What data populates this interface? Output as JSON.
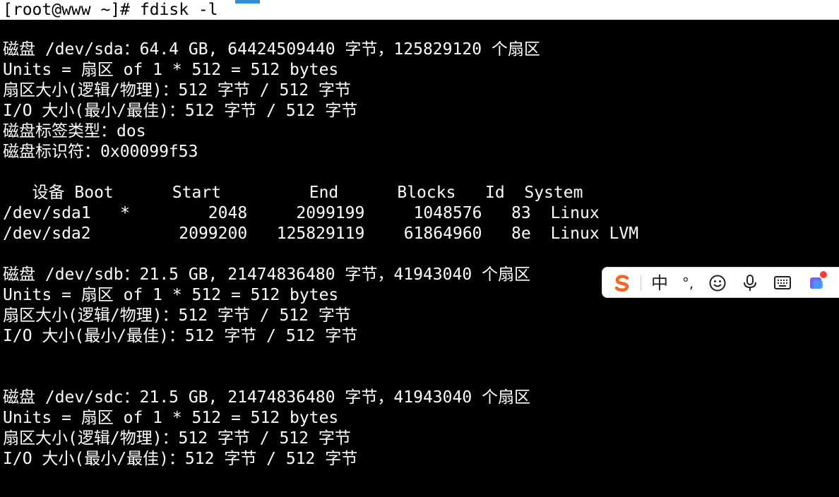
{
  "prompt": {
    "text": "[root@www ~]# fdisk -l"
  },
  "lines": [
    "磁盘 /dev/sda：64.4 GB, 64424509440 字节，125829120 个扇区",
    "Units = 扇区 of 1 * 512 = 512 bytes",
    "扇区大小(逻辑/物理)：512 字节 / 512 字节",
    "I/O 大小(最小/最佳)：512 字节 / 512 字节",
    "磁盘标签类型：dos",
    "磁盘标识符：0x00099f53",
    "   设备 Boot      Start         End      Blocks   Id  System",
    "/dev/sda1   *        2048     2099199     1048576   83  Linux",
    "/dev/sda2         2099200   125829119    61864960   8e  Linux LVM",
    "磁盘 /dev/sdb：21.5 GB, 21474836480 字节，41943040 个扇区",
    "Units = 扇区 of 1 * 512 = 512 bytes",
    "扇区大小(逻辑/物理)：512 字节 / 512 字节",
    "I/O 大小(最小/最佳)：512 字节 / 512 字节",
    "磁盘 /dev/sdc：21.5 GB, 21474836480 字节，41943040 个扇区",
    "Units = 扇区 of 1 * 512 = 512 bytes",
    "扇区大小(逻辑/物理)：512 字节 / 512 字节",
    "I/O 大小(最小/最佳)：512 字节 / 512 字节"
  ],
  "ime_toolbar": {
    "mode_label": "中",
    "punct_label": "°,",
    "icons": [
      "sogou-logo-icon",
      "emoji-icon",
      "microphone-icon",
      "keyboard-icon",
      "skin-icon"
    ],
    "colors": {
      "logo": "#f26522",
      "skin": "#7c5cff",
      "badge": "#ff3b30"
    }
  }
}
